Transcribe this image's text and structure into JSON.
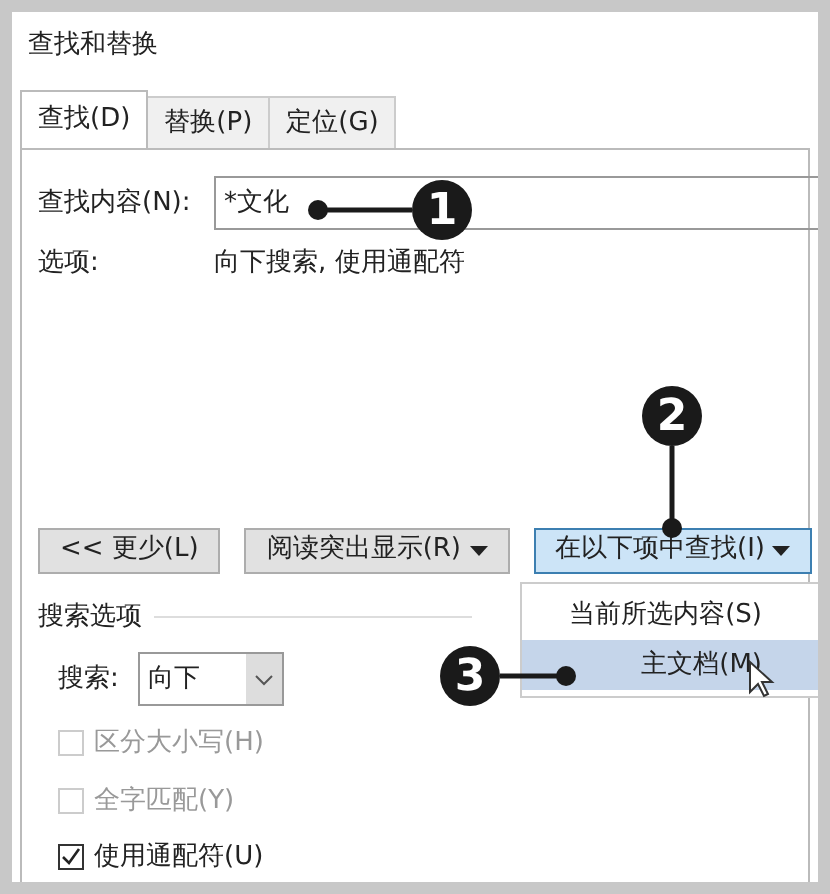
{
  "window": {
    "title": "查找和替换"
  },
  "tabs": [
    {
      "label": "查找(D)",
      "selected": true
    },
    {
      "label": "替换(P)",
      "selected": false
    },
    {
      "label": "定位(G)",
      "selected": false
    }
  ],
  "find": {
    "label": "查找内容(N):",
    "value": "*文化"
  },
  "options": {
    "label": "选项:",
    "value": "向下搜索, 使用通配符"
  },
  "buttons": [
    {
      "label": "<< 更少(L)",
      "dropdown": false,
      "selected": false
    },
    {
      "label": "阅读突出显示(R)",
      "dropdown": true,
      "selected": false
    },
    {
      "label": "在以下项中查找(I)",
      "dropdown": true,
      "selected": true
    }
  ],
  "menu": {
    "items": [
      {
        "label": "当前所选内容(S)",
        "selected": false
      },
      {
        "label": "主文档(M)",
        "selected": true
      }
    ]
  },
  "search_options": {
    "title": "搜索选项",
    "direction_label": "搜索:",
    "direction_value": "向下",
    "checkboxes": [
      {
        "label": "区分大小写(H)",
        "checked": false,
        "disabled": true
      },
      {
        "label": "全字匹配(Y)",
        "checked": false,
        "disabled": true
      },
      {
        "label": "使用通配符(U)",
        "checked": true,
        "disabled": false
      }
    ]
  },
  "callouts": [
    "1",
    "2",
    "3"
  ]
}
